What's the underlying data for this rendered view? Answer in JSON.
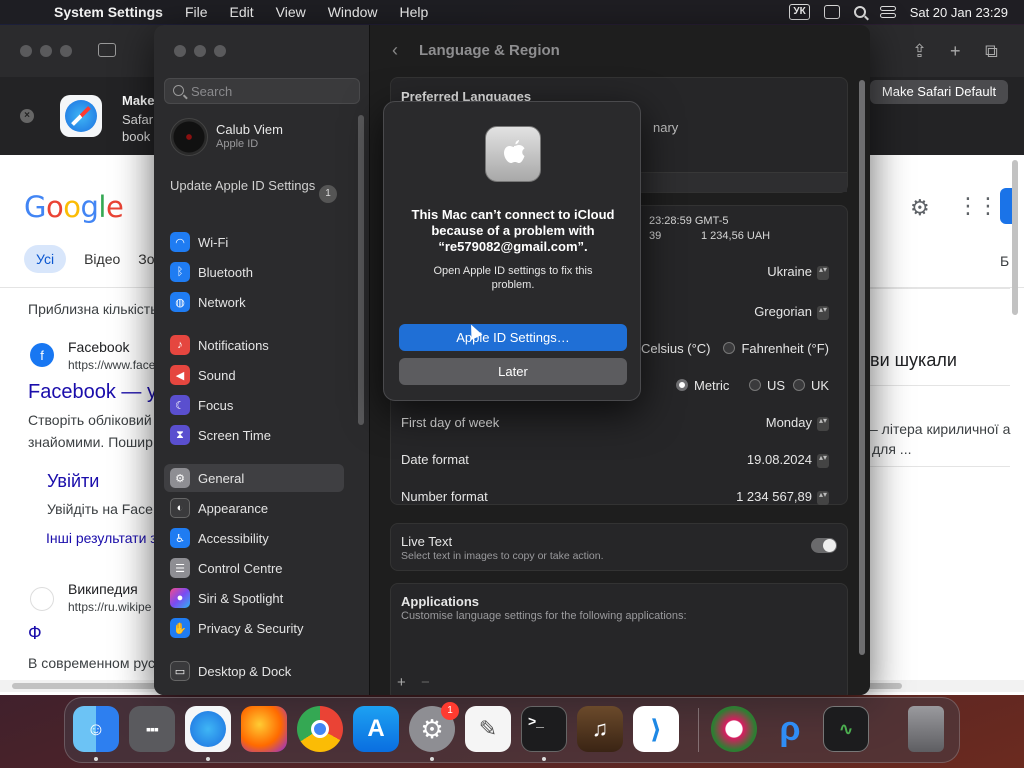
{
  "menubar": {
    "app_name": "System Settings",
    "menus": [
      "File",
      "Edit",
      "View",
      "Window",
      "Help"
    ],
    "keyboard_layout": "УК",
    "datetime": "Sat 20 Jan  23:29"
  },
  "safari": {
    "banner": {
      "title": "Make",
      "line2": "Safar",
      "line3": "book",
      "make_default_label": "Make Safari Default"
    },
    "google": {
      "logo": "Google",
      "tabs": [
        "Усі",
        "Відео",
        "Зо"
      ],
      "results_count": "Приблизна кількість",
      "result1_site": "Facebook",
      "result1_url": "https://www.face",
      "result1_title": "Facebook — у",
      "result1_snippet1": "Створіть обліковий",
      "result1_snippet2": "знайомими. Пошир",
      "sub_link_title": "Увійти",
      "sub_link_snippet": "Увійдіть на Face",
      "more_results": "Інші результати з",
      "result2_site": "Википедия",
      "result2_url": "https://ru.wikipe",
      "result2_title": "Ф",
      "result2_snippet": "В современном рус",
      "right_heading": "ви шукали",
      "right_snippet1": "– літера кириличної а",
      "right_snippet2": "для ...",
      "right_edge_letter": "Б"
    }
  },
  "settings": {
    "search_placeholder": "Search",
    "account": {
      "name": "Calub Viem",
      "sub": "Apple ID"
    },
    "update": {
      "label": "Update Apple ID Settings",
      "badge": "1"
    },
    "sidebar": [
      {
        "label": "Wi-Fi",
        "icon": "wifi-icon",
        "color": "#1f7cf2"
      },
      {
        "label": "Bluetooth",
        "icon": "bluetooth-icon",
        "color": "#1f7cf2"
      },
      {
        "label": "Network",
        "icon": "globe-icon",
        "color": "#1f7cf2"
      },
      {
        "label": "Notifications",
        "icon": "bell-icon",
        "color": "#e5463f"
      },
      {
        "label": "Sound",
        "icon": "speaker-icon",
        "color": "#e5463f"
      },
      {
        "label": "Focus",
        "icon": "moon-icon",
        "color": "#5a4fcf"
      },
      {
        "label": "Screen Time",
        "icon": "hourglass-icon",
        "color": "#5a4fcf"
      },
      {
        "label": "General",
        "icon": "gear-icon",
        "color": "#8e8e93"
      },
      {
        "label": "Appearance",
        "icon": "appearance-icon",
        "color": "#3a3a3c"
      },
      {
        "label": "Accessibility",
        "icon": "accessibility-icon",
        "color": "#1f7cf2"
      },
      {
        "label": "Control Centre",
        "icon": "control-centre-icon",
        "color": "#8e8e93"
      },
      {
        "label": "Siri & Spotlight",
        "icon": "siri-icon",
        "color": "#b14fd6"
      },
      {
        "label": "Privacy & Security",
        "icon": "hand-icon",
        "color": "#1f7cf2"
      },
      {
        "label": "Desktop & Dock",
        "icon": "dock-icon",
        "color": "#3a3a3c"
      }
    ],
    "page_title": "Language & Region",
    "preferred_languages": "Preferred Languages",
    "partial_primary": "nary",
    "partial_time": "23:28:59 GMT-5",
    "partial_number": "39",
    "partial_currency": "1 234,56 UAH",
    "region_value": "Ukraine",
    "calendar_value": "Gregorian",
    "temperature": {
      "celsius": "Celsius (°C)",
      "fahrenheit": "Fahrenheit (°F)"
    },
    "measurement": {
      "metric": "Metric",
      "us": "US",
      "uk": "UK"
    },
    "first_day": {
      "label": "First day of week",
      "value": "Monday"
    },
    "date_format": {
      "label": "Date format",
      "value": "19.08.2024"
    },
    "number_format": {
      "label": "Number format",
      "value": "1 234 567,89"
    },
    "live_text": {
      "label": "Live Text",
      "desc": "Select text in images to copy or take action."
    },
    "applications": {
      "label": "Applications",
      "desc": "Customise language settings for the following applications:",
      "add": "+",
      "remove": "−"
    }
  },
  "alert": {
    "title": "This Mac can’t connect to iCloud because of a problem with “re579082@gmail.com”.",
    "message": "Open Apple ID settings to fix this problem.",
    "primary_button": "Apple ID Settings…",
    "secondary_button": "Later"
  },
  "dock": {
    "settings_badge": "1",
    "terminal_prompt": ">_"
  }
}
